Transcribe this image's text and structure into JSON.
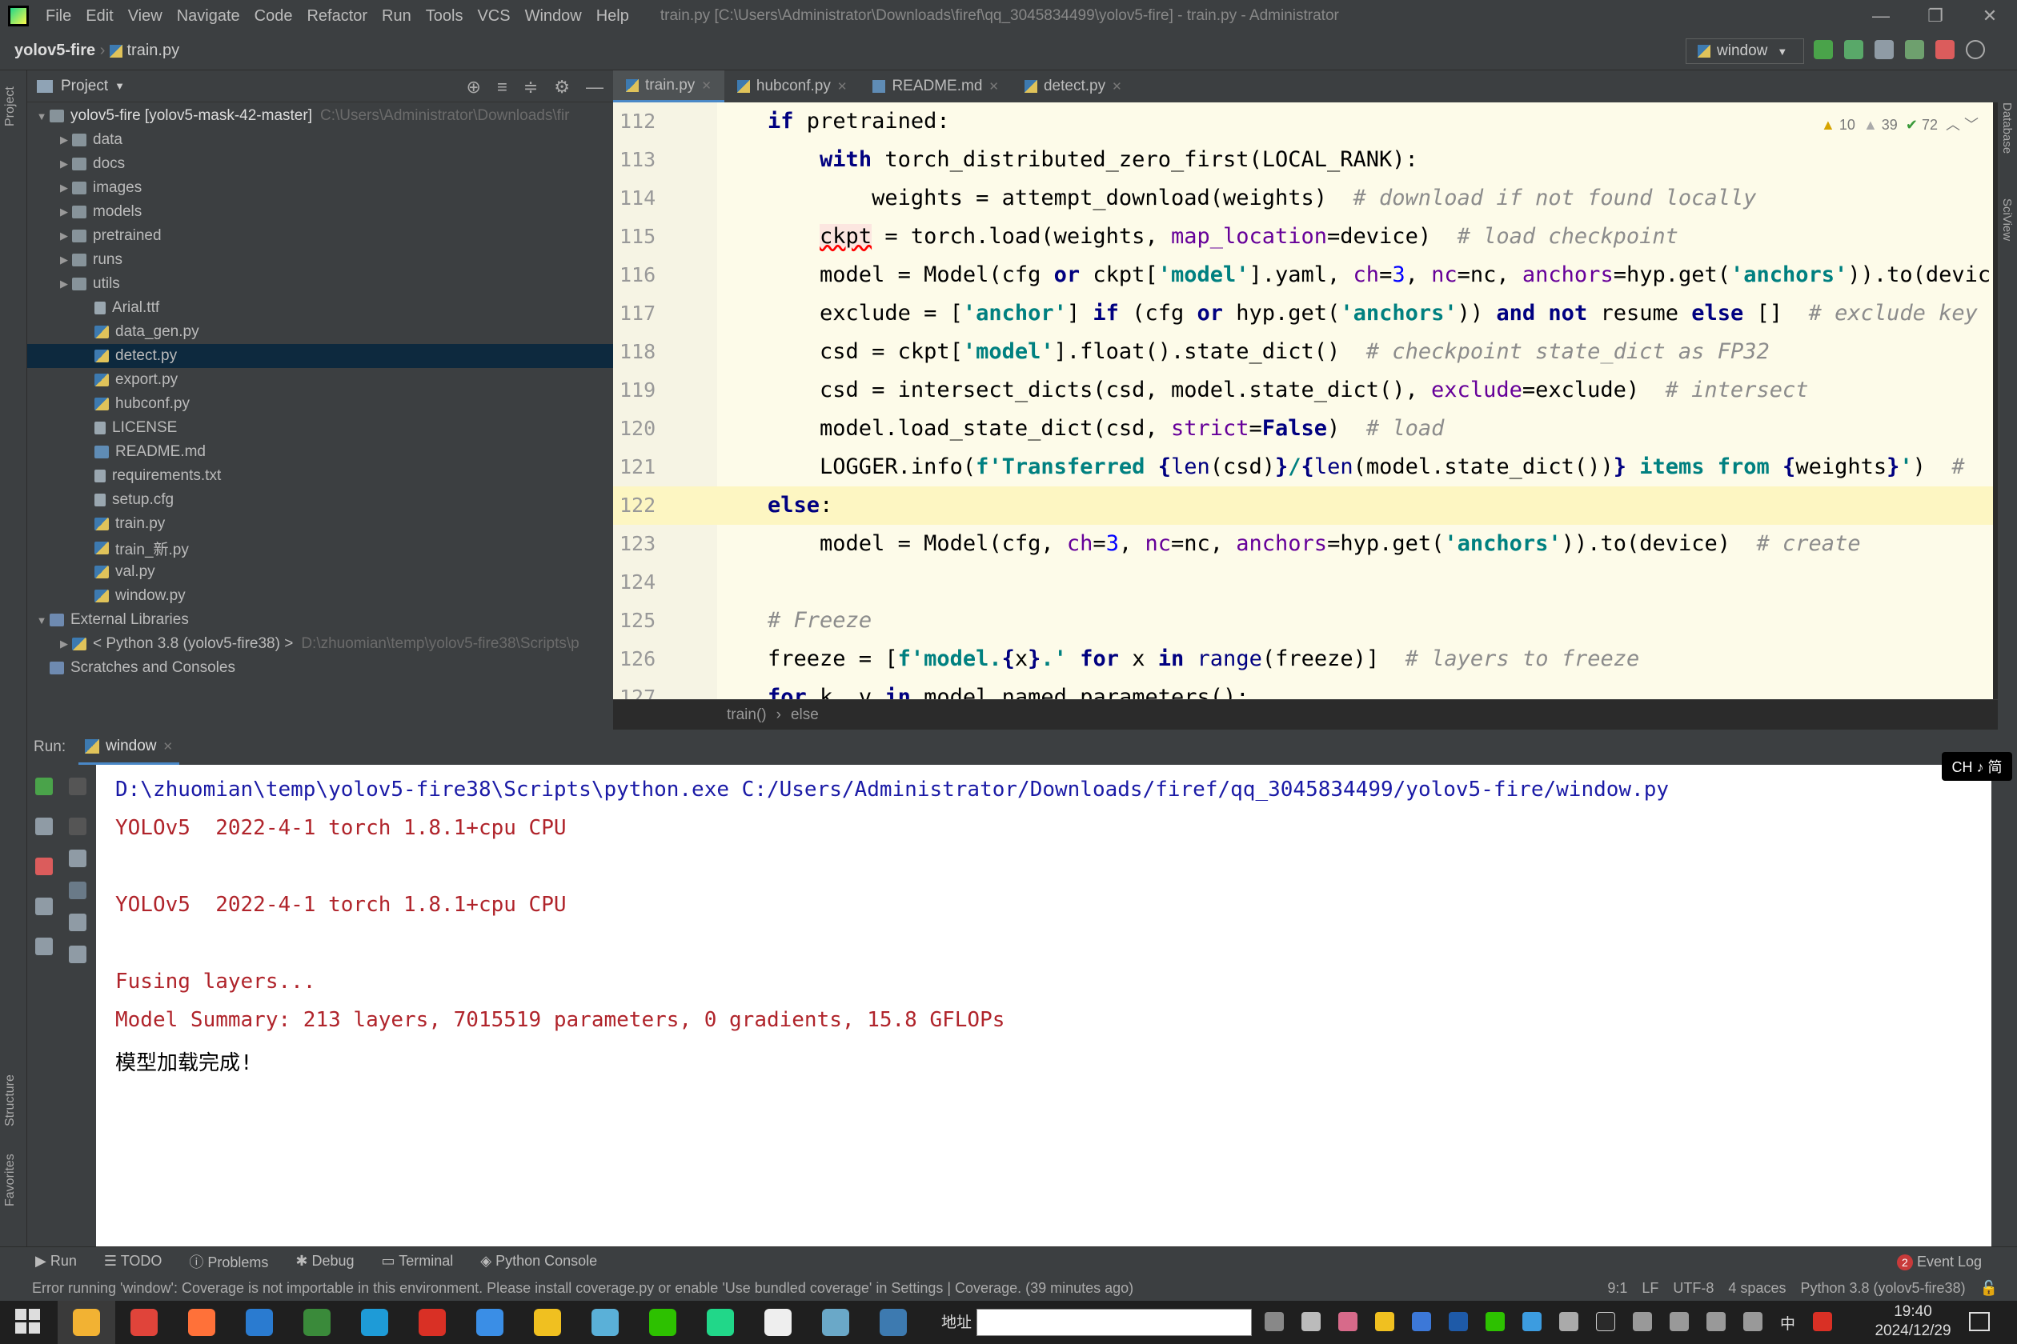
{
  "window": {
    "menu": [
      "File",
      "Edit",
      "View",
      "Navigate",
      "Code",
      "Refactor",
      "Run",
      "Tools",
      "VCS",
      "Window",
      "Help"
    ],
    "title": "train.py [C:\\Users\\Administrator\\Downloads\\firef\\qq_3045834499\\yolov5-fire] - train.py - Administrator"
  },
  "navbar": {
    "project": "yolov5-fire",
    "file": "train.py",
    "run_config": "window"
  },
  "left_strip": {
    "project": "Project",
    "structure": "Structure",
    "favorites": "Favorites"
  },
  "right_strip": {
    "database": "Database",
    "sciview": "SciView"
  },
  "project_panel": {
    "title": "Project",
    "tree": [
      {
        "label": "yolov5-fire [yolov5-mask-42-master]",
        "path": "C:\\Users\\Administrator\\Downloads\\fir",
        "type": "folder",
        "indent": 0,
        "arrow": "v"
      },
      {
        "label": "data",
        "type": "folder",
        "indent": 1,
        "arrow": ">"
      },
      {
        "label": "docs",
        "type": "folder",
        "indent": 1,
        "arrow": ">"
      },
      {
        "label": "images",
        "type": "folder",
        "indent": 1,
        "arrow": ">"
      },
      {
        "label": "models",
        "type": "folder",
        "indent": 1,
        "arrow": ">"
      },
      {
        "label": "pretrained",
        "type": "folder",
        "indent": 1,
        "arrow": ">"
      },
      {
        "label": "runs",
        "type": "folder",
        "indent": 1,
        "arrow": ">"
      },
      {
        "label": "utils",
        "type": "folder",
        "indent": 1,
        "arrow": ">"
      },
      {
        "label": "Arial.ttf",
        "type": "txt",
        "indent": 2
      },
      {
        "label": "data_gen.py",
        "type": "py",
        "indent": 2
      },
      {
        "label": "detect.py",
        "type": "py",
        "indent": 2,
        "selected": true
      },
      {
        "label": "export.py",
        "type": "py",
        "indent": 2
      },
      {
        "label": "hubconf.py",
        "type": "py",
        "indent": 2
      },
      {
        "label": "LICENSE",
        "type": "txt",
        "indent": 2
      },
      {
        "label": "README.md",
        "type": "md",
        "indent": 2
      },
      {
        "label": "requirements.txt",
        "type": "txt",
        "indent": 2
      },
      {
        "label": "setup.cfg",
        "type": "txt",
        "indent": 2
      },
      {
        "label": "train.py",
        "type": "py",
        "indent": 2
      },
      {
        "label": "train_新.py",
        "type": "py",
        "indent": 2
      },
      {
        "label": "val.py",
        "type": "py",
        "indent": 2
      },
      {
        "label": "window.py",
        "type": "py",
        "indent": 2
      },
      {
        "label": "External Libraries",
        "type": "lib",
        "indent": 0,
        "arrow": "v"
      },
      {
        "label": "< Python 3.8 (yolov5-fire38) >",
        "path": "D:\\zhuomian\\temp\\yolov5-fire38\\Scripts\\p",
        "type": "py",
        "indent": 1,
        "arrow": ">"
      },
      {
        "label": "Scratches and Consoles",
        "type": "lib",
        "indent": 0
      }
    ]
  },
  "editor": {
    "tabs": [
      "train.py",
      "hubconf.py",
      "README.md",
      "detect.py"
    ],
    "inspection": {
      "warnings": "10",
      "weak": "39",
      "ok": "72"
    },
    "breadcrumb": [
      "train()",
      "else"
    ],
    "lines": [
      {
        "n": "112",
        "html": "    <span class='kw'>if</span> pretrained:"
      },
      {
        "n": "113",
        "html": "        <span class='kw'>with</span> torch_distributed_zero_first(LOCAL_RANK):"
      },
      {
        "n": "114",
        "html": "            weights = attempt_download(weights)  <span class='cm'># download if not found locally</span>"
      },
      {
        "n": "115",
        "html": "        <span class='err'>ckpt</span> = torch.load(weights, <span class='param'>map_location</span>=device)  <span class='cm'># load checkpoint</span>"
      },
      {
        "n": "116",
        "html": "        model = Model(cfg <span class='kw'>or</span> ckpt[<span class='str'>'model'</span>].yaml, <span class='param'>ch</span>=<span class='num'>3</span>, <span class='param'>nc</span>=nc, <span class='param'>anchors</span>=hyp.get(<span class='str'>'anchors'</span>)).to(devic"
      },
      {
        "n": "117",
        "html": "        exclude = [<span class='str'>'anchor'</span>] <span class='kw'>if</span> (cfg <span class='kw'>or</span> hyp.get(<span class='str'>'anchors'</span>)) <span class='kw'>and not</span> resume <span class='kw'>else</span> []  <span class='cm'># exclude key</span>"
      },
      {
        "n": "118",
        "html": "        csd = ckpt[<span class='str'>'model'</span>].float().state_dict()  <span class='cm'># checkpoint state_dict as FP32</span>"
      },
      {
        "n": "119",
        "html": "        csd = intersect_dicts(csd, model.state_dict(), <span class='param'>exclude</span>=exclude)  <span class='cm'># intersect</span>"
      },
      {
        "n": "120",
        "html": "        model.load_state_dict(csd, <span class='param'>strict</span>=<span class='kw'>False</span>)  <span class='cm'># load</span>"
      },
      {
        "n": "121",
        "html": "        LOGGER.info(<span class='str'>f'Transferred </span><span class='kw'>{</span><span class='fn'>len</span>(csd)<span class='kw'>}</span><span class='str'>/</span><span class='kw'>{</span><span class='fn'>len</span>(model.state_dict())<span class='kw'>}</span><span class='str'> items from </span><span class='kw'>{</span>weights<span class='kw'>}</span><span class='str'>'</span>)  <span class='cm'>#</span>"
      },
      {
        "n": "122",
        "html": "    <span class='kw'>else</span>:",
        "current": true
      },
      {
        "n": "123",
        "html": "        model = Model(cfg, <span class='param'>ch</span>=<span class='num'>3</span>, <span class='param'>nc</span>=nc, <span class='param'>anchors</span>=hyp.get(<span class='str'>'anchors'</span>)).to(device)  <span class='cm'># create</span>"
      },
      {
        "n": "124",
        "html": ""
      },
      {
        "n": "125",
        "html": "    <span class='cm'># Freeze</span>"
      },
      {
        "n": "126",
        "html": "    freeze = [<span class='str'>f'model.</span><span class='kw'>{</span>x<span class='kw'>}</span><span class='str'>.'</span> <span class='kw'>for</span> x <span class='kw'>in</span> <span class='fn'>range</span>(freeze)]  <span class='cm'># layers to freeze</span>"
      },
      {
        "n": "127",
        "html": "    <span class='kw'>for</span> k, v <span class='kw'>in</span> model.named_parameters():"
      }
    ]
  },
  "run_panel": {
    "label": "Run:",
    "tab": "window",
    "output": [
      {
        "text": "D:\\zhuomian\\temp\\yolov5-fire38\\Scripts\\python.exe C:/Users/Administrator/Downloads/firef/qq_3045834499/yolov5-fire/window.py",
        "cls": "blue"
      },
      {
        "text": "YOLOv5  2022-4-1 torch 1.8.1+cpu CPU",
        "cls": "red"
      },
      {
        "text": "",
        "cls": "red"
      },
      {
        "text": "YOLOv5  2022-4-1 torch 1.8.1+cpu CPU",
        "cls": "red"
      },
      {
        "text": "",
        "cls": "red"
      },
      {
        "text": "Fusing layers... ",
        "cls": "red"
      },
      {
        "text": "Model Summary: 213 layers, 7015519 parameters, 0 gradients, 15.8 GFLOPs",
        "cls": "red"
      },
      {
        "text": "模型加载完成!",
        "cls": "black"
      }
    ]
  },
  "ime_badge": "CH ♪ 简",
  "tool_windows": [
    "Run",
    "TODO",
    "Problems",
    "Debug",
    "Terminal",
    "Python Console"
  ],
  "event_log": "Event Log",
  "event_count": "2",
  "status": {
    "message": "Error running 'window': Coverage is not importable in this environment. Please install coverage.py or enable 'Use bundled coverage' in Settings | Coverage. (39 minutes ago)",
    "position": "9:1",
    "line_sep": "LF",
    "encoding": "UTF-8",
    "indent": "4 spaces",
    "interpreter": "Python 3.8 (yolov5-fire38)"
  },
  "taskbar": {
    "address_label": "地址",
    "time": "19:40",
    "date": "2024/12/29",
    "input_lang": "中",
    "apps": [
      "start",
      "file-explorer",
      "chrome",
      "firefox",
      "vim",
      "excel-like",
      "edge",
      "wps",
      "sogou",
      "qq-game",
      "color-app",
      "wechat",
      "pycharm",
      "typora",
      "notepad",
      "python"
    ],
    "colors": {
      "chrome": "#e0443a",
      "firefox": "#ff7139",
      "edge": "#1e9bd7",
      "wps": "#d93025",
      "pycharm": "#21d789",
      "wechat": "#2dc100"
    }
  }
}
